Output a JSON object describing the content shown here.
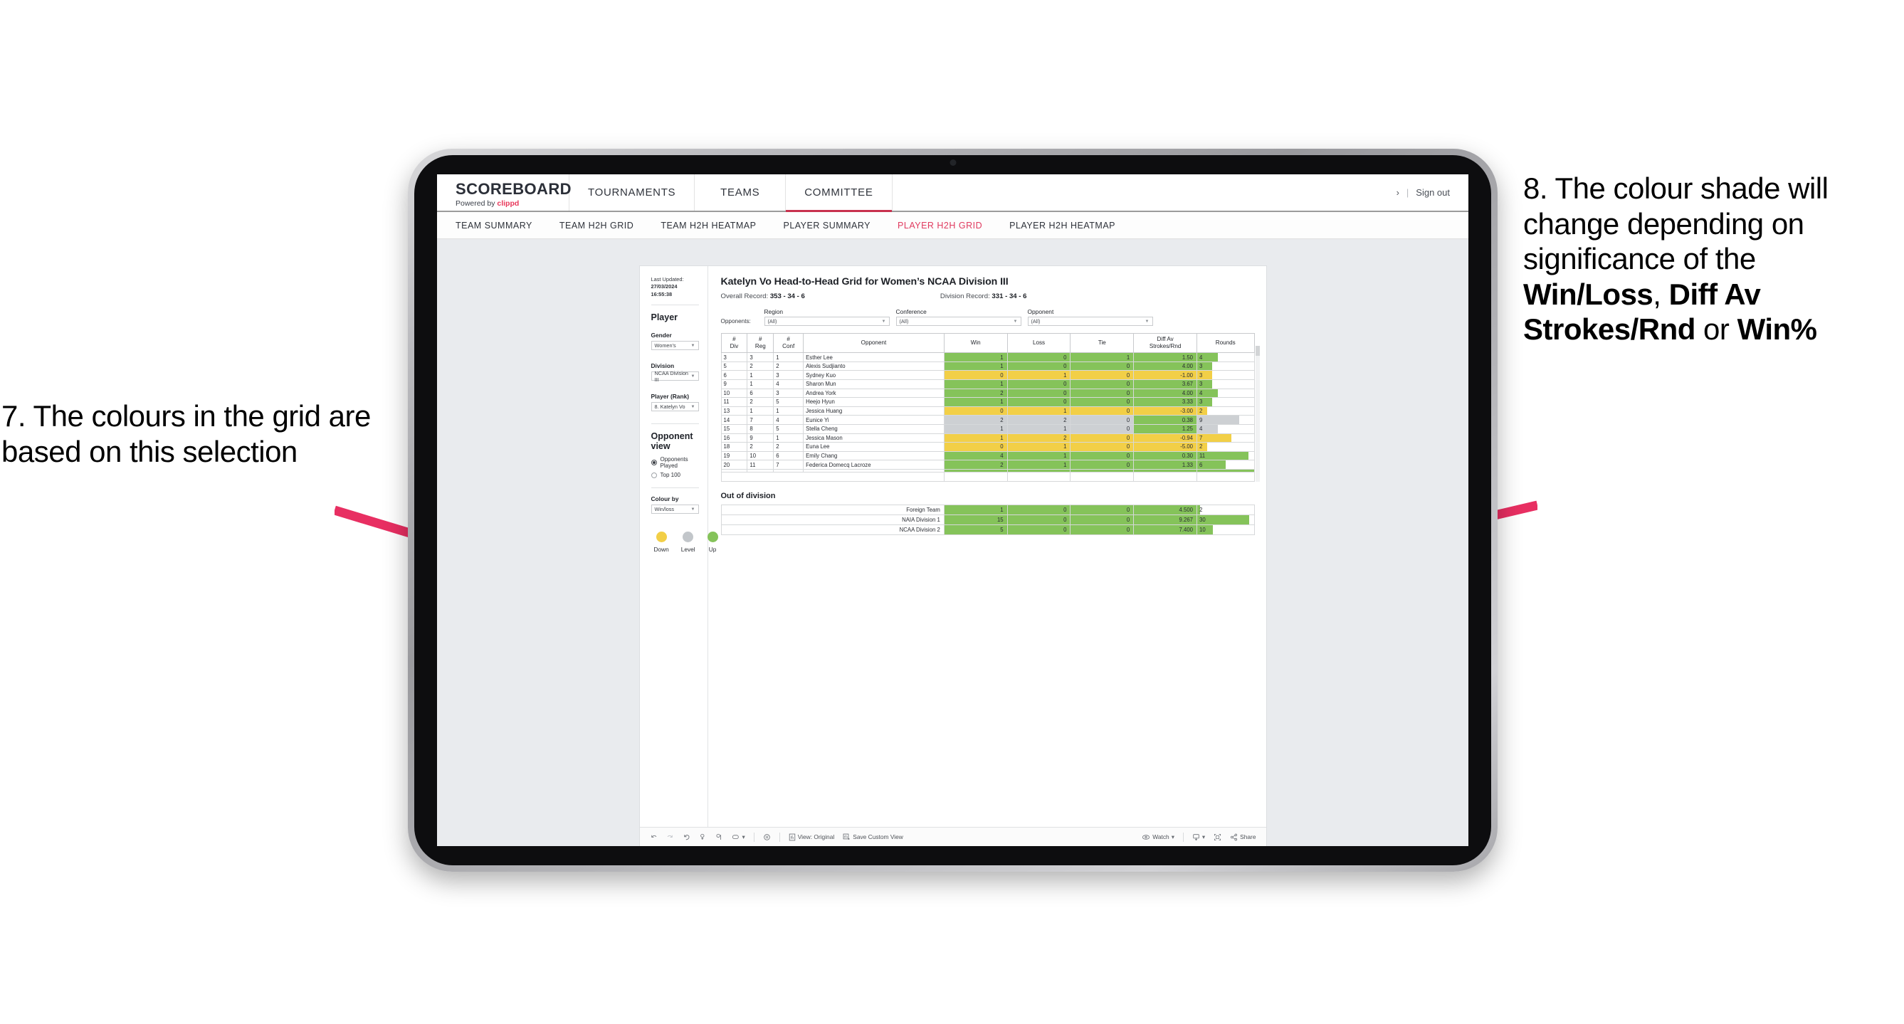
{
  "annotations": {
    "left": "7. The colours in the grid are based on this selection",
    "right_parts": [
      {
        "text": "8. The colour shade will change depending on significance of the ",
        "bold": false
      },
      {
        "text": "Win/Loss",
        "bold": true
      },
      {
        "text": ", ",
        "bold": false
      },
      {
        "text": "Diff Av Strokes/Rnd",
        "bold": true
      },
      {
        "text": " or ",
        "bold": false
      },
      {
        "text": "Win%",
        "bold": true
      }
    ]
  },
  "header": {
    "brand_title": "SCOREBOARD",
    "brand_sub_prefix": "Powered by ",
    "brand_sub_name": "clippd",
    "tabs": [
      {
        "label": "TOURNAMENTS",
        "active": false
      },
      {
        "label": "TEAMS",
        "active": false
      },
      {
        "label": "COMMITTEE",
        "active": true
      }
    ],
    "chevron": "›",
    "separator": "|",
    "sign_out": "Sign out"
  },
  "subnav": {
    "tabs": [
      {
        "label": "TEAM SUMMARY",
        "active": false
      },
      {
        "label": "TEAM H2H GRID",
        "active": false
      },
      {
        "label": "TEAM H2H HEATMAP",
        "active": false
      },
      {
        "label": "PLAYER SUMMARY",
        "active": false
      },
      {
        "label": "PLAYER H2H GRID",
        "active": true
      },
      {
        "label": "PLAYER H2H HEATMAP",
        "active": false
      }
    ]
  },
  "sidebar": {
    "last_updated_label": "Last Updated: ",
    "last_updated_date": "27/03/2024",
    "last_updated_time": "16:55:38",
    "section_player": "Player",
    "gender_label": "Gender",
    "gender_value": "Women’s",
    "division_label": "Division",
    "division_value": "NCAA Division III",
    "player_label": "Player (Rank)",
    "player_value": "8. Katelyn Vo",
    "opponent_view_label": "Opponent view",
    "opponent_view_options": [
      {
        "label": "Opponents Played",
        "selected": true
      },
      {
        "label": "Top 100",
        "selected": false
      }
    ],
    "colour_by_label": "Colour by",
    "colour_by_value": "Win/loss",
    "legend": [
      {
        "label": "Down",
        "color": "#f2cf47"
      },
      {
        "label": "Level",
        "color": "#c2c6ca"
      },
      {
        "label": "Up",
        "color": "#85c35a"
      }
    ]
  },
  "main": {
    "title": "Katelyn Vo Head-to-Head Grid for Women’s NCAA Division III",
    "overall_record_label": "Overall Record: ",
    "overall_record_value": "353 -  34 - 6",
    "division_record_label": "Division Record: ",
    "division_record_value": "331 -  34 - 6",
    "opponents_label": "Opponents:",
    "filters": [
      {
        "label": "Region",
        "value": "(All)"
      },
      {
        "label": "Conference",
        "value": "(All)"
      },
      {
        "label": "Opponent",
        "value": "(All)"
      }
    ]
  },
  "chart_data": {
    "type": "table",
    "title": "Katelyn Vo Head-to-Head Grid for Women’s NCAA Division III",
    "columns": [
      "# Div",
      "# Reg",
      "# Conf",
      "Opponent",
      "Win",
      "Loss",
      "Tie",
      "Diff Av Strokes/Rnd",
      "Rounds"
    ],
    "column_headers_multiline": [
      {
        "l1": "#",
        "l2": "Div"
      },
      {
        "l1": "#",
        "l2": "Reg"
      },
      {
        "l1": "#",
        "l2": "Conf"
      },
      {
        "l1": "Opponent",
        "l2": ""
      },
      {
        "l1": "Win",
        "l2": ""
      },
      {
        "l1": "Loss",
        "l2": ""
      },
      {
        "l1": "Tie",
        "l2": ""
      },
      {
        "l1": "Diff Av",
        "l2": "Strokes/Rnd"
      },
      {
        "l1": "Rounds",
        "l2": ""
      }
    ],
    "colour_scale": {
      "up": "#85c35a",
      "level": "#cdd0d3",
      "down": "#f2cf47"
    },
    "rows": [
      {
        "div": "3",
        "reg": "3",
        "conf": "1",
        "opponent": "Esther Lee",
        "win": "1",
        "loss": "0",
        "tie": "1",
        "diff": "1.50",
        "rounds": "4",
        "tone": "up",
        "bar_pct": 36
      },
      {
        "div": "5",
        "reg": "2",
        "conf": "2",
        "opponent": "Alexis Sudjianto",
        "win": "1",
        "loss": "0",
        "tie": "0",
        "diff": "4.00",
        "rounds": "3",
        "tone": "up",
        "bar_pct": 27
      },
      {
        "div": "6",
        "reg": "1",
        "conf": "3",
        "opponent": "Sydney Kuo",
        "win": "0",
        "loss": "1",
        "tie": "0",
        "diff": "-1.00",
        "rounds": "3",
        "tone": "down",
        "bar_pct": 27
      },
      {
        "div": "9",
        "reg": "1",
        "conf": "4",
        "opponent": "Sharon Mun",
        "win": "1",
        "loss": "0",
        "tie": "0",
        "diff": "3.67",
        "rounds": "3",
        "tone": "up",
        "bar_pct": 27
      },
      {
        "div": "10",
        "reg": "6",
        "conf": "3",
        "opponent": "Andrea York",
        "win": "2",
        "loss": "0",
        "tie": "0",
        "diff": "4.00",
        "rounds": "4",
        "tone": "up",
        "bar_pct": 36
      },
      {
        "div": "11",
        "reg": "2",
        "conf": "5",
        "opponent": "Heejo Hyun",
        "win": "1",
        "loss": "0",
        "tie": "0",
        "diff": "3.33",
        "rounds": "3",
        "tone": "up",
        "bar_pct": 27
      },
      {
        "div": "13",
        "reg": "1",
        "conf": "1",
        "opponent": "Jessica Huang",
        "win": "0",
        "loss": "1",
        "tie": "0",
        "diff": "-3.00",
        "rounds": "2",
        "tone": "down",
        "bar_pct": 18
      },
      {
        "div": "14",
        "reg": "7",
        "conf": "4",
        "opponent": "Eunice Yi",
        "win": "2",
        "loss": "2",
        "tie": "0",
        "diff": "0.38",
        "rounds": "9",
        "tone": "level",
        "diff_tone": "up",
        "bar_pct": 74
      },
      {
        "div": "15",
        "reg": "8",
        "conf": "5",
        "opponent": "Stella Cheng",
        "win": "1",
        "loss": "1",
        "tie": "0",
        "diff": "1.25",
        "rounds": "4",
        "tone": "level",
        "diff_tone": "up",
        "bar_pct": 36
      },
      {
        "div": "16",
        "reg": "9",
        "conf": "1",
        "opponent": "Jessica Mason",
        "win": "1",
        "loss": "2",
        "tie": "0",
        "diff": "-0.94",
        "rounds": "7",
        "tone": "down",
        "bar_pct": 60
      },
      {
        "div": "18",
        "reg": "2",
        "conf": "2",
        "opponent": "Euna Lee",
        "win": "0",
        "loss": "1",
        "tie": "0",
        "diff": "-5.00",
        "rounds": "2",
        "tone": "down",
        "bar_pct": 18
      },
      {
        "div": "19",
        "reg": "10",
        "conf": "6",
        "opponent": "Emily Chang",
        "win": "4",
        "loss": "1",
        "tie": "0",
        "diff": "0.30",
        "rounds": "11",
        "tone": "up",
        "bar_pct": 90
      },
      {
        "div": "20",
        "reg": "11",
        "conf": "7",
        "opponent": "Federica Domecq Lacroze",
        "win": "2",
        "loss": "1",
        "tie": "0",
        "diff": "1.33",
        "rounds": "6",
        "tone": "up",
        "bar_pct": 50
      }
    ],
    "out_of_division": {
      "title": "Out of division",
      "rows": [
        {
          "name": "Foreign Team",
          "win": "1",
          "loss": "0",
          "tie": "0",
          "diff": "4.500",
          "rounds": "2",
          "tone": "up",
          "bar_pct": 5
        },
        {
          "name": "NAIA Division 1",
          "win": "15",
          "loss": "0",
          "tie": "0",
          "diff": "9.267",
          "rounds": "30",
          "tone": "up",
          "bar_pct": 92
        },
        {
          "name": "NCAA Division 2",
          "win": "5",
          "loss": "0",
          "tie": "0",
          "diff": "7.400",
          "rounds": "10",
          "tone": "up",
          "bar_pct": 28
        }
      ]
    }
  },
  "toolbar": {
    "view_label": "View: Original",
    "save_label": "Save Custom View",
    "watch_label": "Watch",
    "share_label": "Share",
    "caret": "▾"
  }
}
